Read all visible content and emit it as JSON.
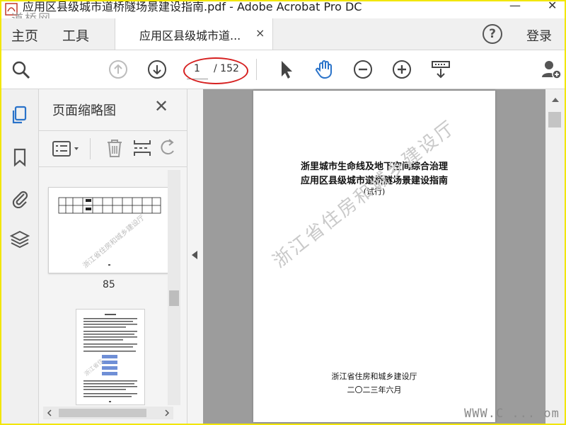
{
  "window": {
    "title": "应用区县级城市道桥隧场景建设指南.pdf - Adobe Acrobat Pro DC",
    "watermark": "道桥网"
  },
  "menu": {
    "home": "主页",
    "tools": "工具"
  },
  "tab": {
    "label": "应用区县级城市道...",
    "close": "×"
  },
  "header": {
    "help": "?",
    "signin": "登录"
  },
  "toolbar": {
    "current_page": "1",
    "total_pages": "/ 152"
  },
  "panel": {
    "title": "页面缩略图",
    "close": "✕",
    "thumb1_label": "85"
  },
  "document": {
    "title_line1": "浙里城市生命线及地下空间综合治理",
    "title_line2": "应用区县级城市道桥隧场景建设指南",
    "title_line3": "(试行)",
    "watermark": "浙江省住房和城乡建设厅",
    "org": "浙江省住房和城乡建设厅",
    "date": "二〇二三年六月"
  },
  "footer": {
    "site_watermark": "WWW.C ... om"
  },
  "colors": {
    "accent_blue": "#2a73c9",
    "highlight_red": "#d62020",
    "frame_yellow": "#f2e600"
  }
}
